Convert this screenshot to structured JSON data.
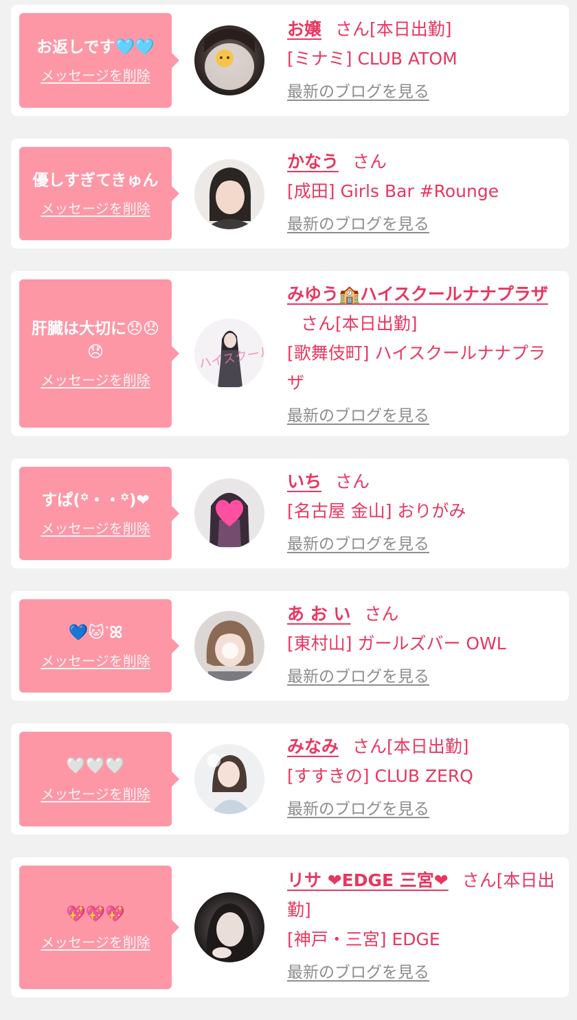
{
  "common": {
    "delete_label": "メッセージを削除",
    "blog_label": "最新のブログを見る",
    "san": "さん"
  },
  "colors": {
    "bubble": "#fd97a6",
    "accent": "#e8365f",
    "link_gray": "#8c8c8c",
    "background": "#f1f1f1"
  },
  "messages": [
    {
      "text": "お返しです🩵🩵",
      "name": "お嬢",
      "suffix": "[本日出勤]",
      "shop": "[ミナミ] CLUB ATOM",
      "avatar": "cat-sticker-face-photo"
    },
    {
      "text": "優しすぎてきゅん",
      "name": "かなう",
      "suffix": "",
      "shop": "[成田] Girls Bar #Rounge",
      "avatar": "woman-with-bangs-photo"
    },
    {
      "text": "肝臓は大切に😞😞😞",
      "name": "みゆう🏫ハイスクールナナプラザ",
      "suffix": "[本日出勤]",
      "shop": "[歌舞伎町] ハイスクールナナプラザ",
      "avatar": "woman-in-white-room-photo"
    },
    {
      "text": "すぱ(꙳・・꙳)❤",
      "name": "いち",
      "suffix": "",
      "shop": "[名古屋 金山] おりがみ",
      "avatar": "heart-sticker-face-photo"
    },
    {
      "text": "💙🐱ᐝꕤ",
      "name": "あ お い",
      "suffix": "",
      "shop": "[東村山] ガールズバー OWL",
      "avatar": "short-hair-woman-photo"
    },
    {
      "text": "🤍🤍🤍",
      "name": "みなみ",
      "suffix": "[本日出勤]",
      "shop": "[すすきの] CLUB ZERQ",
      "avatar": "woman-light-dress-photo"
    },
    {
      "text": "💖💖💖",
      "name": "リサ ❤EDGE 三宮❤",
      "suffix": "[本日出勤]",
      "shop": "[神戸・三宮] EDGE",
      "avatar": "woman-dark-hair-photo"
    }
  ]
}
